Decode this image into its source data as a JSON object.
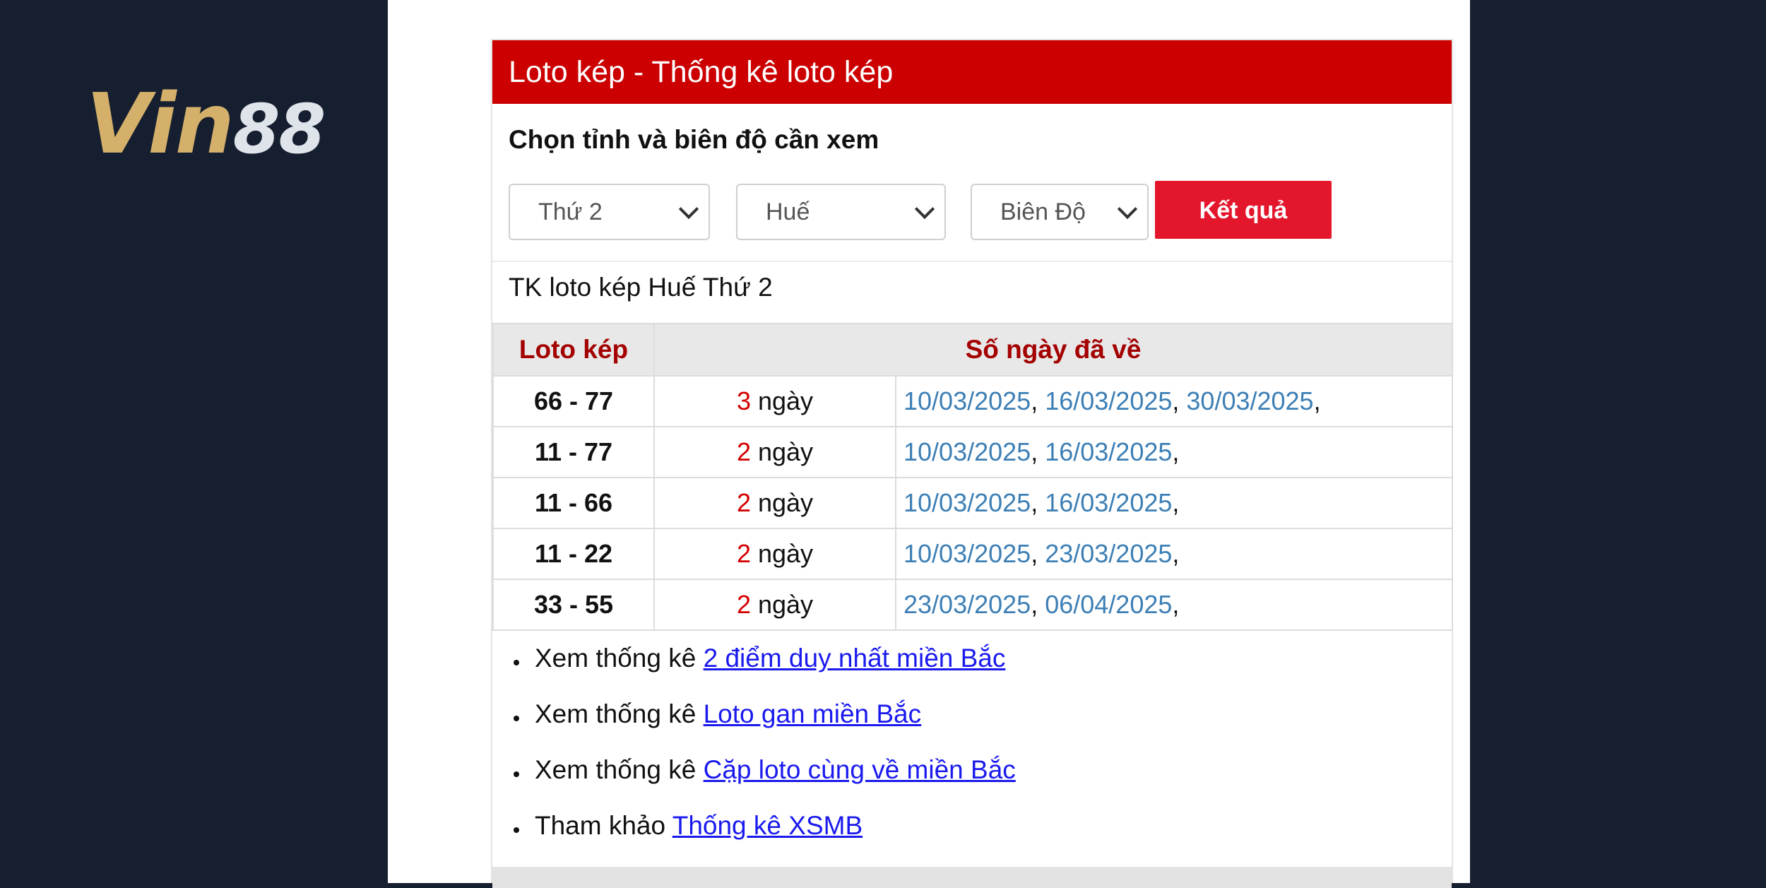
{
  "brand": {
    "logo_text_1": "Vin",
    "logo_text_2": "88"
  },
  "widget": {
    "title": "Loto kép - Thống kê loto kép",
    "choose_label": "Chọn tỉnh và biên độ cần xem",
    "selects": {
      "day": "Thứ 2",
      "province": "Huế",
      "range": "Biên Độ"
    },
    "submit_label": "Kết quả",
    "subtitle": "TK loto kép Huế Thứ 2",
    "table": {
      "headers": [
        "Loto kép",
        "Số ngày đã về"
      ],
      "unit": "ngày",
      "rows": [
        {
          "pair": "66 - 77",
          "count": "3",
          "dates": [
            "10/03/2025",
            "16/03/2025",
            "30/03/2025"
          ]
        },
        {
          "pair": "11 - 77",
          "count": "2",
          "dates": [
            "10/03/2025",
            "16/03/2025"
          ]
        },
        {
          "pair": "11 - 66",
          "count": "2",
          "dates": [
            "10/03/2025",
            "16/03/2025"
          ]
        },
        {
          "pair": "11 - 22",
          "count": "2",
          "dates": [
            "10/03/2025",
            "23/03/2025"
          ]
        },
        {
          "pair": "33 - 55",
          "count": "2",
          "dates": [
            "23/03/2025",
            "06/04/2025"
          ]
        }
      ]
    },
    "links": [
      {
        "prefix": "Xem thống kê",
        "link": "2 điểm duy nhất miền Bắc"
      },
      {
        "prefix": "Xem thống kê",
        "link": "Loto gan miền Bắc"
      },
      {
        "prefix": "Xem thống kê",
        "link": "Cặp loto cùng về miền Bắc"
      },
      {
        "prefix": "Tham khảo",
        "link": "Thống kê XSMB"
      }
    ]
  },
  "colors": {
    "header": "#cc0000",
    "button": "#e3162c",
    "date": "#3d7fb5",
    "link": "#1a1aee",
    "background": "#161f30"
  }
}
